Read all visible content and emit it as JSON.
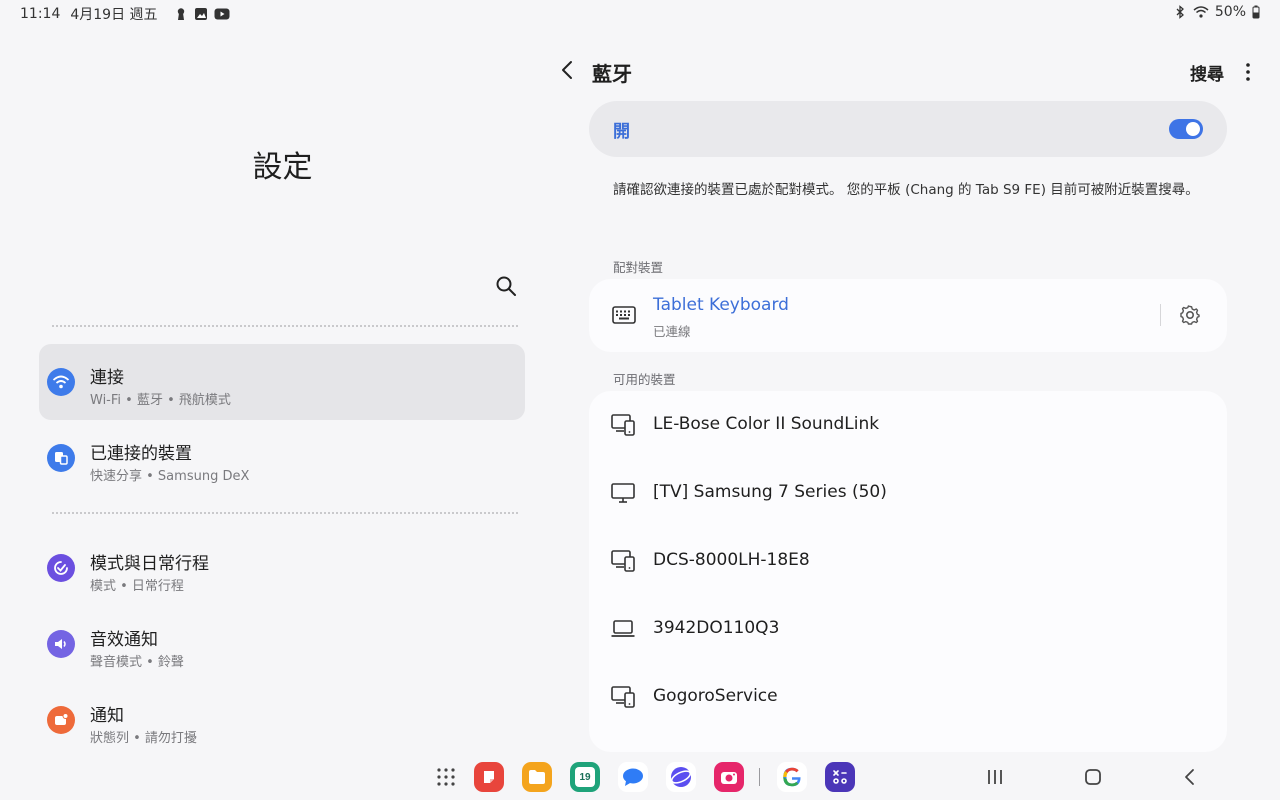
{
  "status_bar": {
    "time": "11:14",
    "date": "4月19日 週五",
    "notification_icons": [
      "keyhole-icon",
      "gallery-icon",
      "youtube-icon"
    ],
    "right_icons": [
      "bluetooth-icon",
      "wifi-icon"
    ],
    "battery": "50%"
  },
  "left_panel": {
    "title": "設定",
    "items": [
      {
        "title": "連接",
        "subtitle": "Wi-Fi • 藍牙 • 飛航模式",
        "icon": "wifi-icon",
        "color": "#3e7bea",
        "active": true
      },
      {
        "title": "已連接的裝置",
        "subtitle": "快速分享 • Samsung DeX",
        "icon": "devices-icon",
        "color": "#3e7bea",
        "active": false
      },
      {
        "title": "模式與日常行程",
        "subtitle": "模式 • 日常行程",
        "icon": "check-circle-icon",
        "color": "#6b4fe0",
        "active": false
      },
      {
        "title": "音效通知",
        "subtitle": "聲音模式 • 鈴聲",
        "icon": "speaker-icon",
        "color": "#7464e3",
        "active": false
      },
      {
        "title": "通知",
        "subtitle": "狀態列 • 請勿打擾",
        "icon": "notification-icon",
        "color": "#ee6a3a",
        "active": false
      }
    ]
  },
  "right_panel": {
    "title": "藍牙",
    "search_label": "搜尋",
    "toggle_label": "開",
    "toggle_on": true,
    "info_text": "請確認欲連接的裝置已處於配對模式。 您的平板 (Chang 的 Tab S9 FE) 目前可被附近裝置搜尋。",
    "paired_section_label": "配對裝置",
    "paired_device": {
      "name": "Tablet Keyboard",
      "status": "已連線"
    },
    "available_section_label": "可用的裝置",
    "available_devices": [
      {
        "name": "LE-Bose Color II SoundLink",
        "icon": "phone-monitor-icon"
      },
      {
        "name": "[TV] Samsung 7 Series (50)",
        "icon": "tv-icon"
      },
      {
        "name": "DCS-8000LH-18E8",
        "icon": "phone-monitor-icon"
      },
      {
        "name": "3942DO110Q3",
        "icon": "laptop-icon"
      },
      {
        "name": "GogoroService",
        "icon": "phone-monitor-icon"
      }
    ]
  },
  "taskbar": {
    "apps": [
      {
        "name": "app-drawer-icon",
        "color": ""
      },
      {
        "name": "notes-app-icon",
        "color": "#e8453c"
      },
      {
        "name": "my-files-icon",
        "color": "#f4a41d"
      },
      {
        "name": "calendar-icon",
        "color": "#1fa37a",
        "label": "19"
      },
      {
        "name": "messages-icon",
        "color": "#2f7cf6"
      },
      {
        "name": "internet-icon",
        "color": "#5b4ef0"
      },
      {
        "name": "camera-icon",
        "color": "#e6266a"
      },
      {
        "name": "google-icon",
        "color": "#ffffff"
      },
      {
        "name": "calculator-icon",
        "color": "#4b36b8"
      }
    ],
    "nav": [
      "recents-button",
      "home-button",
      "back-button"
    ]
  }
}
